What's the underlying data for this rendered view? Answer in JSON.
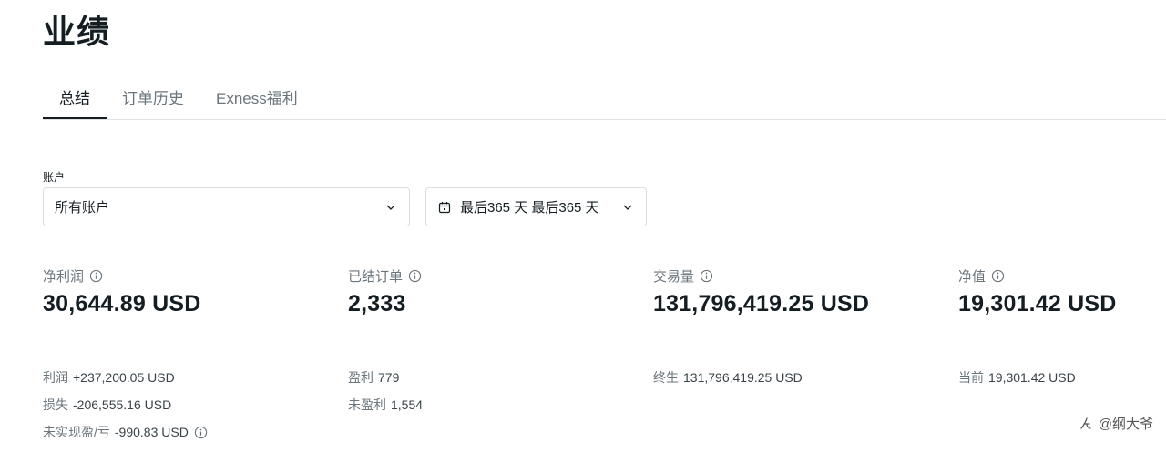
{
  "page": {
    "title": "业绩"
  },
  "tabs": [
    {
      "label": "总结",
      "active": true
    },
    {
      "label": "订单历史",
      "active": false
    },
    {
      "label": "Exness福利",
      "active": false
    }
  ],
  "filters": {
    "account_label": "账户",
    "account_value": "所有账户",
    "date_value": "最后365 天 最后365 天"
  },
  "stats": [
    {
      "label": "净利润",
      "value": "30,644.89 USD",
      "details": [
        {
          "key": "利润",
          "val": "+237,200.05 USD"
        },
        {
          "key": "损失",
          "val": "-206,555.16 USD"
        },
        {
          "key": "未实现盈/亏",
          "val": "-990.83 USD"
        }
      ]
    },
    {
      "label": "已结订单",
      "value": "2,333",
      "details": [
        {
          "key": "盈利",
          "val": "779"
        },
        {
          "key": "未盈利",
          "val": "1,554"
        }
      ]
    },
    {
      "label": "交易量",
      "value": "131,796,419.25 USD",
      "details": [
        {
          "key": "终生",
          "val": "131,796,419.25 USD"
        }
      ]
    },
    {
      "label": "净值",
      "value": "19,301.42 USD",
      "details": [
        {
          "key": "当前",
          "val": "19,301.42 USD"
        }
      ]
    }
  ],
  "watermark": {
    "text": "@纲大爷"
  },
  "colors": {
    "text_primary": "#141d22",
    "text_secondary": "#6b757c",
    "border": "#d9dde1"
  },
  "icons": {
    "info": "info-circle-icon",
    "calendar": "calendar-icon",
    "chevron": "chevron-down-icon"
  }
}
